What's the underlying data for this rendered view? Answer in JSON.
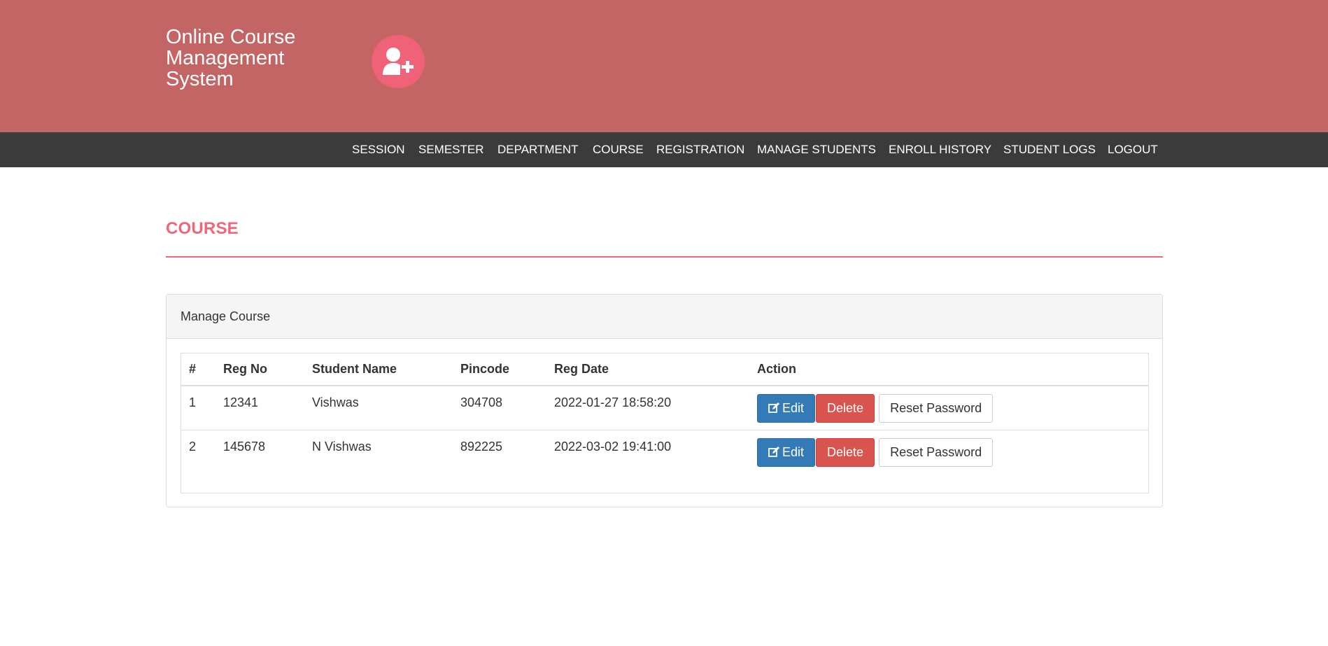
{
  "header": {
    "brand_lines": [
      "Online Course",
      "Management",
      "System"
    ],
    "logo_icon": "user-plus-icon",
    "background_color": "#c46565",
    "logo_color": "#f06277"
  },
  "nav": {
    "items": [
      {
        "label": "SESSION"
      },
      {
        "label": "SEMESTER"
      },
      {
        "label": "DEPARTMENT"
      },
      {
        "label": "COURSE"
      },
      {
        "label": "REGISTRATION"
      },
      {
        "label": "MANAGE STUDENTS"
      },
      {
        "label": "ENROLL HISTORY"
      },
      {
        "label": "STUDENT LOGS"
      },
      {
        "label": "LOGOUT"
      }
    ],
    "background_color": "#3b3b3b"
  },
  "page": {
    "title": "COURSE",
    "accent_color": "#f0677a"
  },
  "panel": {
    "heading": "Manage Course",
    "table": {
      "headers": [
        "#",
        "Reg No",
        "Student Name",
        "Pincode",
        "Reg Date",
        "Action"
      ],
      "rows": [
        {
          "num": "1",
          "reg_no": "12341",
          "name": "Vishwas",
          "pincode": "304708",
          "reg_date": "2022-01-27 18:58:20"
        },
        {
          "num": "2",
          "reg_no": "145678",
          "name": "N Vishwas",
          "pincode": "892225",
          "reg_date": "2022-03-02 19:41:00"
        }
      ],
      "actions": {
        "edit_label": "Edit",
        "edit_icon": "edit-icon",
        "delete_label": "Delete",
        "reset_label": "Reset Password"
      }
    }
  }
}
